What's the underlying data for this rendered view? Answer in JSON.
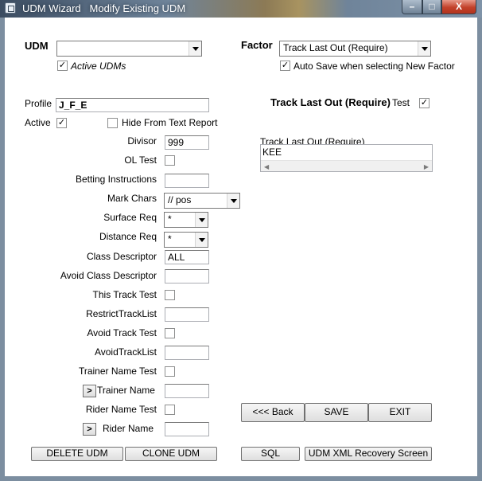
{
  "window": {
    "title": "UDM Wizard",
    "subtitle": "Modify Existing UDM",
    "min_symbol": "–",
    "max_symbol": "□",
    "close_symbol": "X"
  },
  "udm": {
    "label": "UDM",
    "value": "",
    "active_udms_label": "Active UDMs",
    "active_udms_checked": true
  },
  "factor": {
    "label": "Factor",
    "value": "Track Last Out (Require)",
    "auto_save_label": "Auto Save when selecting New Factor",
    "auto_save_checked": true,
    "heading": "Track Last Out (Require)",
    "test_label": "Test",
    "test_checked": true,
    "list_label": "Track Last Out (Require)",
    "list_items": [
      "KEE"
    ]
  },
  "form": {
    "profile_label": "Profile",
    "profile_value": "J_F_E",
    "active_label": "Active",
    "active_checked": true,
    "hide_label": "Hide From Text Report",
    "hide_checked": false,
    "divisor_label": "Divisor",
    "divisor_value": "999",
    "ol_test_label": "OL Test",
    "betting_label": "Betting Instructions",
    "betting_value": "",
    "mark_chars_label": "Mark Chars",
    "mark_chars_value": "// pos",
    "surface_label": "Surface Req",
    "surface_value": "*",
    "distance_label": "Distance Req",
    "distance_value": "*",
    "class_desc_label": "Class Descriptor",
    "class_desc_value": "ALL",
    "avoid_class_label": "Avoid Class Descriptor",
    "avoid_class_value": "",
    "this_track_label": "This Track Test",
    "restrict_label": "RestrictTrackList",
    "restrict_value": "",
    "avoid_track_test_label": "Avoid Track Test",
    "avoid_track_list_label": "AvoidTrackList",
    "avoid_track_list_value": "",
    "trainer_test_label": "Trainer Name Test",
    "trainer_name_label": "Trainer Name",
    "trainer_name_value": "",
    "rider_test_label": "Rider Name Test",
    "rider_name_label": "Rider Name",
    "rider_name_value": "",
    "expand_symbol": ">"
  },
  "buttons": {
    "back": "<<< Back",
    "save": "SAVE",
    "exit": "EXIT",
    "delete": "DELETE UDM",
    "clone": "CLONE UDM",
    "sql": "SQL",
    "recovery": "UDM XML Recovery Screen"
  }
}
